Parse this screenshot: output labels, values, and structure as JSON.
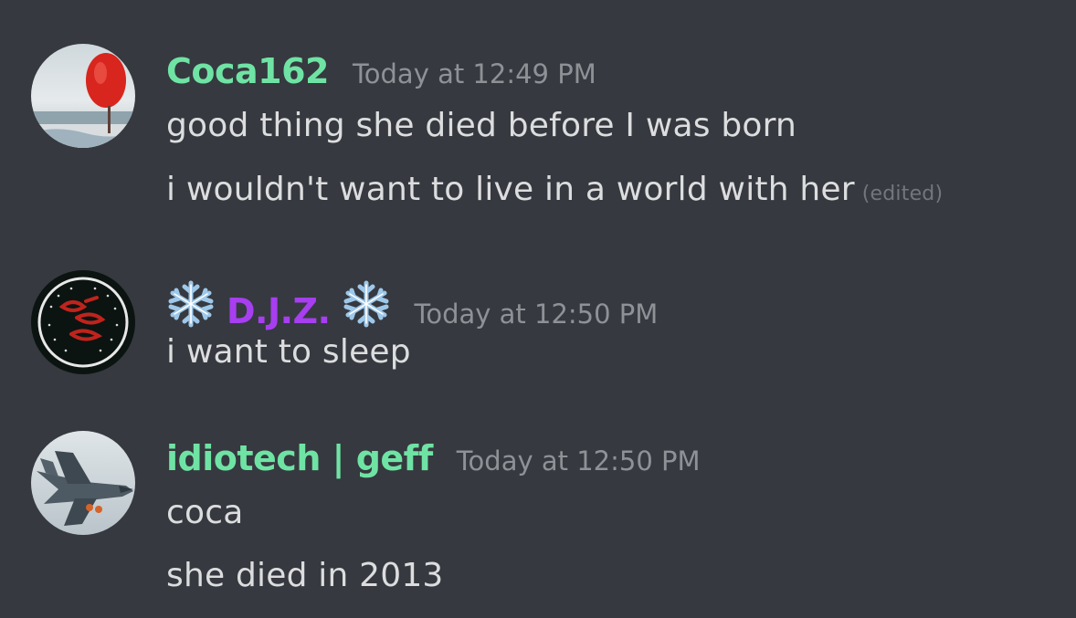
{
  "messages": [
    {
      "username": "Coca162",
      "username_color": "#6fe3a4",
      "timestamp": "Today at 12:49 PM",
      "avatar": "red-balloon-beach-avatar",
      "lines": [
        {
          "text": "good thing she died before I was born"
        },
        {
          "text": "i wouldn't want to live in a world with her",
          "edited_label": "(edited)"
        }
      ]
    },
    {
      "username": "D.J.Z.",
      "username_color": "#a73ef0",
      "username_decoration": "snowflake-icon",
      "timestamp": "Today at 12:50 PM",
      "avatar": "djz-logo-avatar",
      "lines": [
        {
          "text": "i want to sleep"
        }
      ]
    },
    {
      "username": "idiotech | geff",
      "username_color": "#6fe3a4",
      "timestamp": "Today at 12:50 PM",
      "avatar": "fighter-jet-avatar",
      "lines": [
        {
          "text": "coca"
        },
        {
          "text": "she died in 2013"
        }
      ]
    }
  ]
}
